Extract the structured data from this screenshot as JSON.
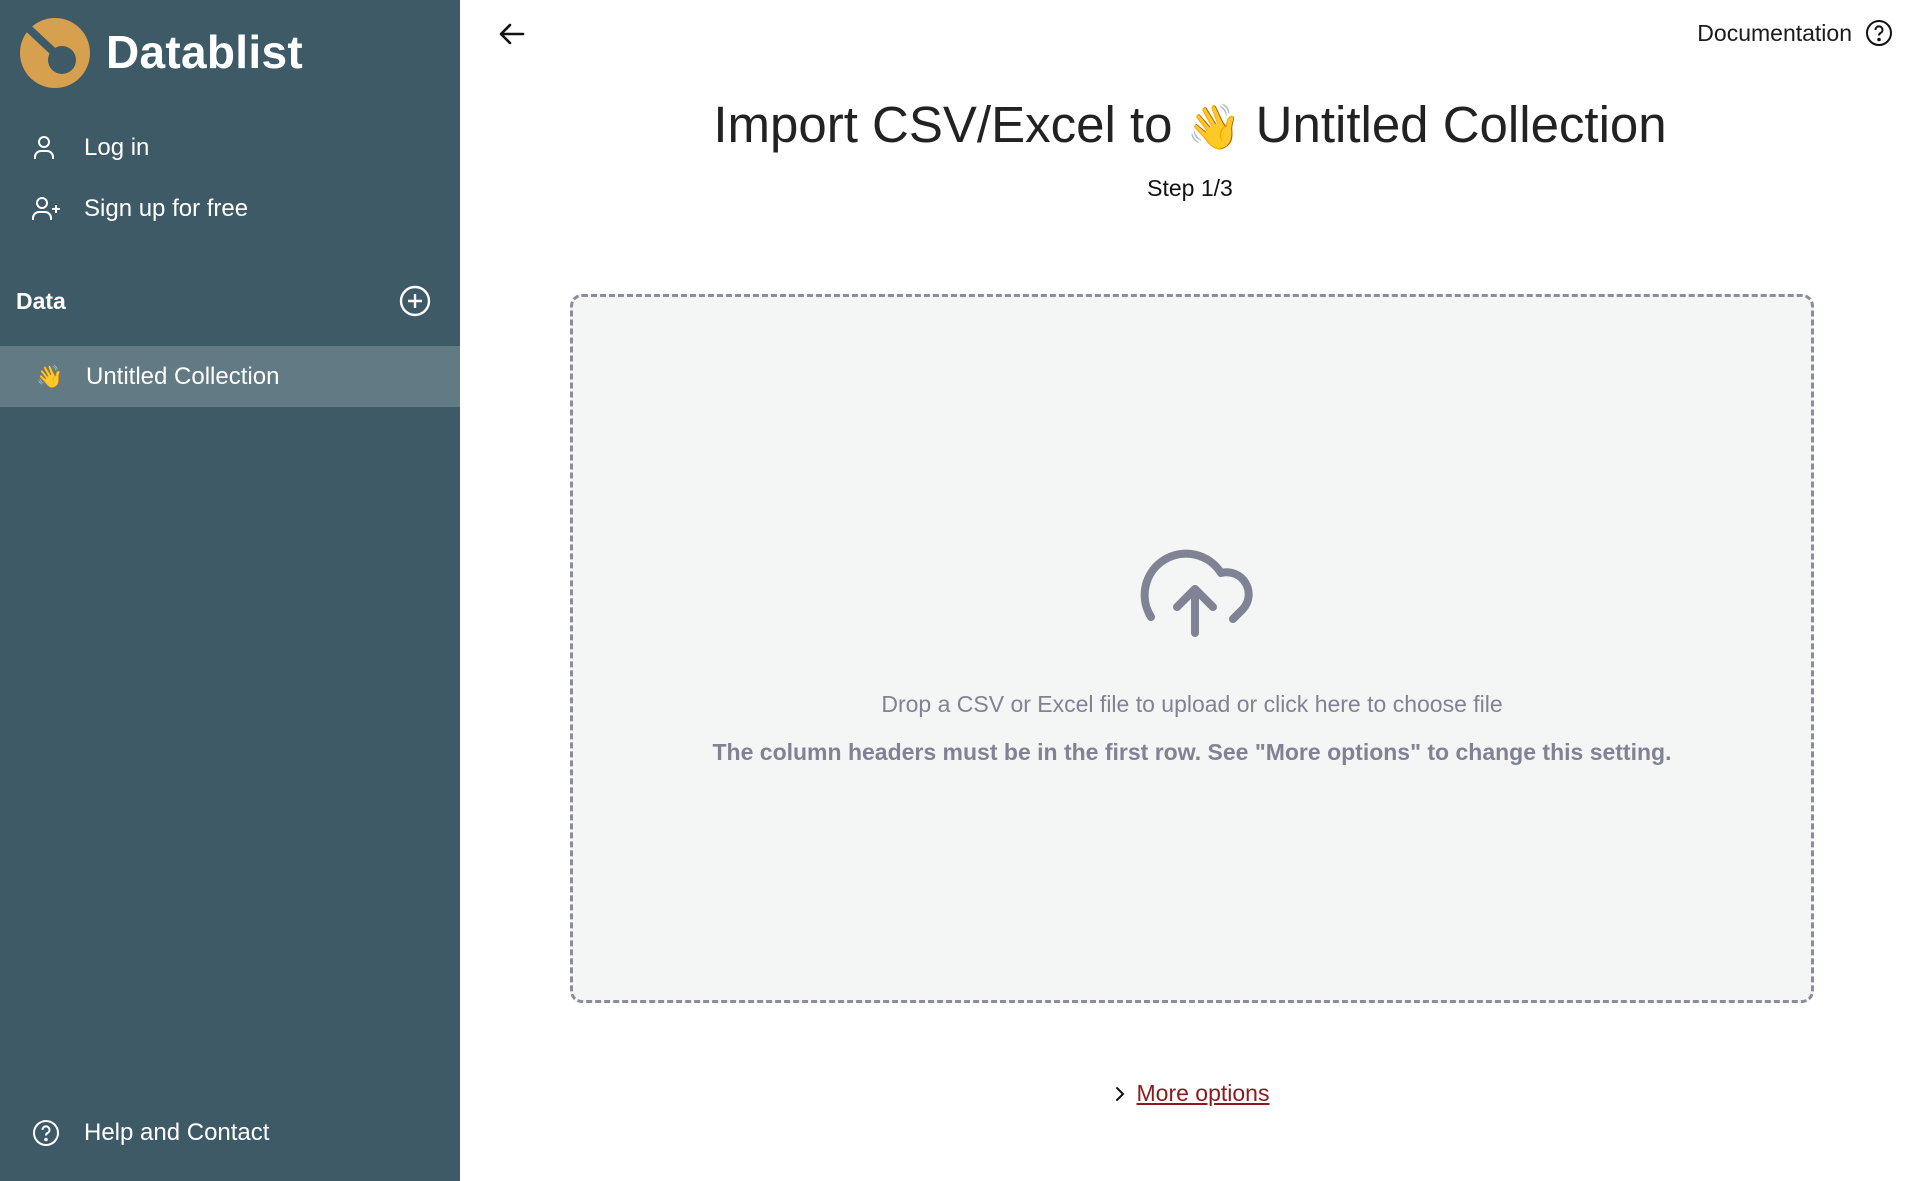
{
  "app": {
    "name": "Datablist",
    "logo_color": "#d6a04f",
    "sidebar_bg": "#3e5a66",
    "selected_bg": "#627a84"
  },
  "sidebar": {
    "auth": [
      {
        "label": "Log in",
        "icon": "user-icon"
      },
      {
        "label": "Sign up for free",
        "icon": "user-plus-icon"
      }
    ],
    "data_section": {
      "title": "Data",
      "add_icon": "plus-circle-icon"
    },
    "collections": [
      {
        "emoji": "👋",
        "label": "Untitled Collection",
        "selected": true
      }
    ],
    "footer": {
      "label": "Help and Contact",
      "icon": "help-circle-icon"
    }
  },
  "header": {
    "back_icon": "arrow-left-icon",
    "documentation": {
      "label": "Documentation",
      "icon": "help-circle-icon"
    }
  },
  "main": {
    "title_prefix": "Import CSV/Excel to ",
    "title_emoji": "👋",
    "title_collection": "Untitled Collection",
    "step": "Step 1/3",
    "dropzone": {
      "icon": "cloud-upload-icon",
      "text": "Drop a CSV or Excel file to upload or click here to choose file",
      "note": "The column headers must be in the first row. See \"More options\" to change this setting."
    },
    "more_options": {
      "label": "More options",
      "icon": "chevron-right-icon",
      "color": "#8b1a1a"
    }
  }
}
